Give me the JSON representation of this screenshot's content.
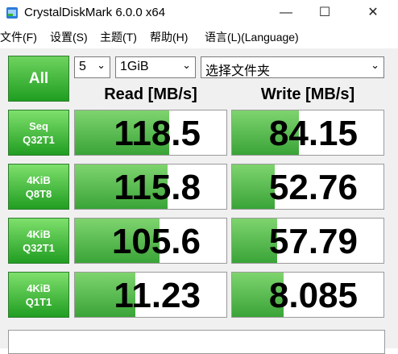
{
  "window": {
    "title": "CrystalDiskMark 6.0.0 x64",
    "minimize_glyph": "—",
    "maximize_glyph": "☐",
    "close_glyph": "✕"
  },
  "menu": [
    "文件(F)",
    "设置(S)",
    "主题(T)",
    "帮助(H)",
    "语言(L)(Language)"
  ],
  "controls": {
    "all_label": "All",
    "count_value": "5",
    "size_value": "1GiB",
    "drive_value": "选择文件夹",
    "chevron": "⌄"
  },
  "headers": {
    "read": "Read [MB/s]",
    "write": "Write [MB/s]"
  },
  "rows": [
    {
      "line1": "Seq",
      "line2": "Q32T1",
      "read": "118.5",
      "write": "84.15",
      "read_fill": 0.62,
      "write_fill": 0.44
    },
    {
      "line1": "4KiB",
      "line2": "Q8T8",
      "read": "115.8",
      "write": "52.76",
      "read_fill": 0.61,
      "write_fill": 0.28
    },
    {
      "line1": "4KiB",
      "line2": "Q32T1",
      "read": "105.6",
      "write": "57.79",
      "read_fill": 0.56,
      "write_fill": 0.3
    },
    {
      "line1": "4KiB",
      "line2": "Q1T1",
      "read": "11.23",
      "write": "8.085",
      "read_fill": 0.4,
      "write_fill": 0.34
    }
  ],
  "accent": "#2fa12f"
}
